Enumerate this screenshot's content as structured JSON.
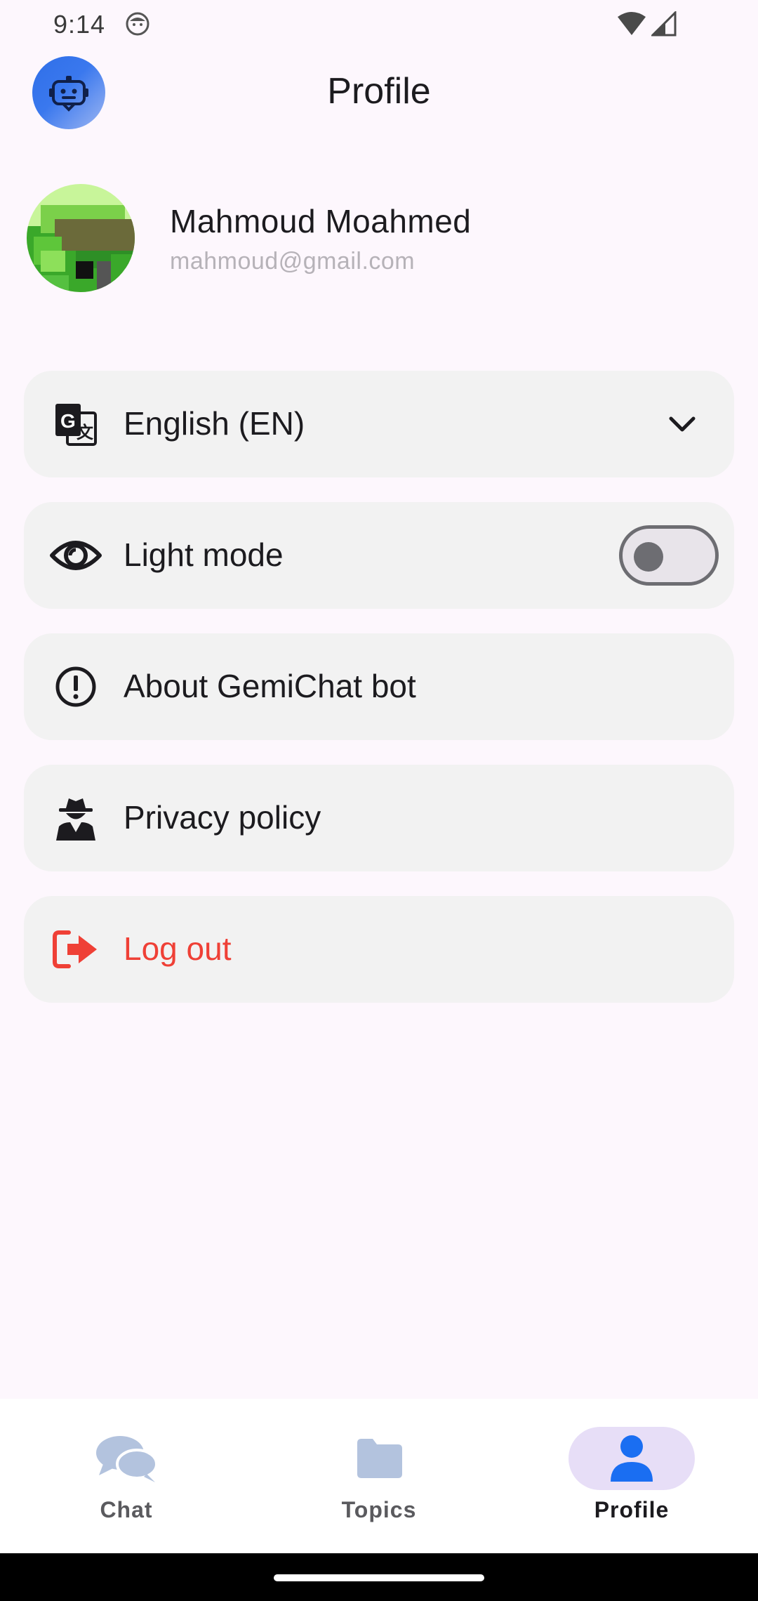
{
  "status_bar": {
    "time": "9:14",
    "icons": [
      "face-notification-icon",
      "wifi-icon",
      "cellular-signal-icon"
    ]
  },
  "app_bar": {
    "title": "Profile",
    "logo_icon": "chatbot-icon",
    "logo_gradient": [
      "#2f6fe8",
      "#9db6f2"
    ]
  },
  "profile": {
    "name": "Mahmoud Moahmed",
    "email": "mahmoud@gmail.com",
    "avatar_icon": "pixel-avatar-image"
  },
  "settings": {
    "language": {
      "label": "English (EN)",
      "icon": "translate-icon",
      "control": "chevron-down-icon"
    },
    "theme": {
      "label": "Light mode",
      "icon": "eye-icon",
      "toggle_on": false
    },
    "about": {
      "label": "About GemiChat bot",
      "icon": "info-exclamation-icon"
    },
    "privacy": {
      "label": "Privacy policy",
      "icon": "spy-agent-icon"
    },
    "logout": {
      "label": "Log out",
      "icon": "logout-icon",
      "color": "#ef4036"
    }
  },
  "bottom_nav": {
    "items": [
      {
        "label": "Chat",
        "icon": "chat-bubbles-icon",
        "active": false
      },
      {
        "label": "Topics",
        "icon": "folder-icon",
        "active": false
      },
      {
        "label": "Profile",
        "icon": "person-icon",
        "active": true
      }
    ],
    "active_color": "#1a6ef2",
    "inactive_icon_color": "#b3c3de",
    "active_indicator_color": "#e7def7"
  },
  "colors": {
    "background": "#fdf7fd",
    "card": "#f2f2f2",
    "danger": "#ef4036"
  }
}
